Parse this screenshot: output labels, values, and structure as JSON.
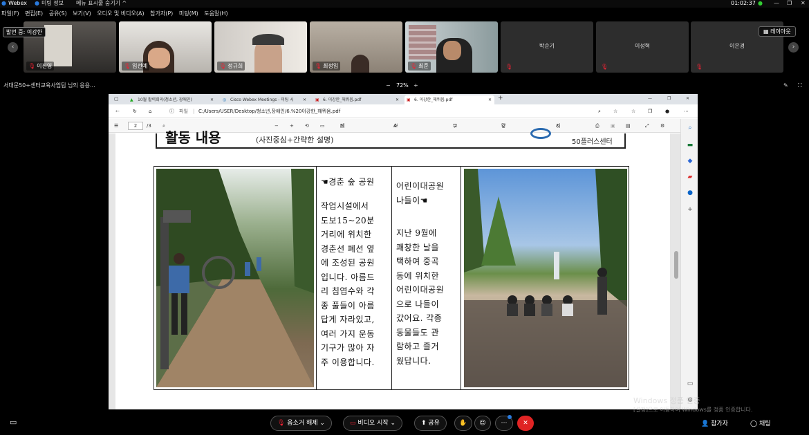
{
  "titlebar": {
    "app": "Webex",
    "meeting_info": "미팅 정보",
    "hide_menu": "메뉴 표시줄 숨기기 ^",
    "time": "01:02:37"
  },
  "menu": [
    "파일(F)",
    "편집(E)",
    "공유(S)",
    "보기(V)",
    "오디오 및 비디오(A)",
    "참가자(P)",
    "미팅(M)",
    "도움말(H)"
  ],
  "speaker": "발언 중: 이강한",
  "layout_label": "레이아웃",
  "participants": [
    {
      "name": "이진영",
      "video": true
    },
    {
      "name": "임선예",
      "video": true
    },
    {
      "name": "정규희",
      "video": true
    },
    {
      "name": "최정임",
      "video": true
    },
    {
      "name": "최준",
      "video": true
    },
    {
      "name": "박순기",
      "video": false
    },
    {
      "name": "이성혁",
      "video": false
    },
    {
      "name": "이은경",
      "video": false
    }
  ],
  "share_title": "서대문50+센터교육사업팀 님의 응용...",
  "zoom": "72%",
  "browser": {
    "tabs": [
      "10월 활력회의(청소년, 장애인)",
      "Cisco Webex Meetings - 미팅 시",
      "6. 이강한_해뮈음.pdf",
      "6. 이강한_해뮈음.pdf"
    ],
    "file_label": "파일",
    "path": "C:/Users/USER/Desktop/청소년,장애인/6.%20이강한_해뮈음.pdf"
  },
  "pdf_toolbar": {
    "page": "2",
    "of": "/3",
    "page_view": "페이지 보기",
    "read_aloud": "소리내어 읽기",
    "draw": "그리기",
    "highlight": "강조 표시",
    "erase": "지우기"
  },
  "document": {
    "header_title": "활동 내용",
    "header_sub": "(사진중심+간략한 설명)",
    "header_right": "50플러스센터",
    "left_title": "☚경춘 숲 공원",
    "left_body": [
      "작업시설에서",
      "도보15~20분",
      "거리에 위치한",
      "경춘선 폐선 옆",
      "에 조성된 공원",
      "입니다. 아름드",
      "리 침엽수와 각",
      "종 풀들이 아름",
      "답게 자라있고,",
      "여러 가지 운동",
      "기구가 많아 자",
      "주 이용합니다."
    ],
    "right_title": [
      "어린이대공원",
      "나들이☚"
    ],
    "right_body": [
      "지난 9월에",
      "쾌창한 날을",
      "택하여 중곡",
      "동에 위치한",
      "어린이대공원",
      "으로 나들이",
      "갔어요. 각종",
      "동물들도 관",
      "람하고 즐거",
      "웠답니다."
    ]
  },
  "watermark": {
    "line1": "Windows 정품 인증",
    "line2": "[설정]으로 이동하여 Windows를 정품 인증합니다."
  },
  "bottom": {
    "mute": "음소거 해제",
    "video": "비디오 시작",
    "share": "공유",
    "participants": "참가자",
    "chat": "채팅"
  }
}
